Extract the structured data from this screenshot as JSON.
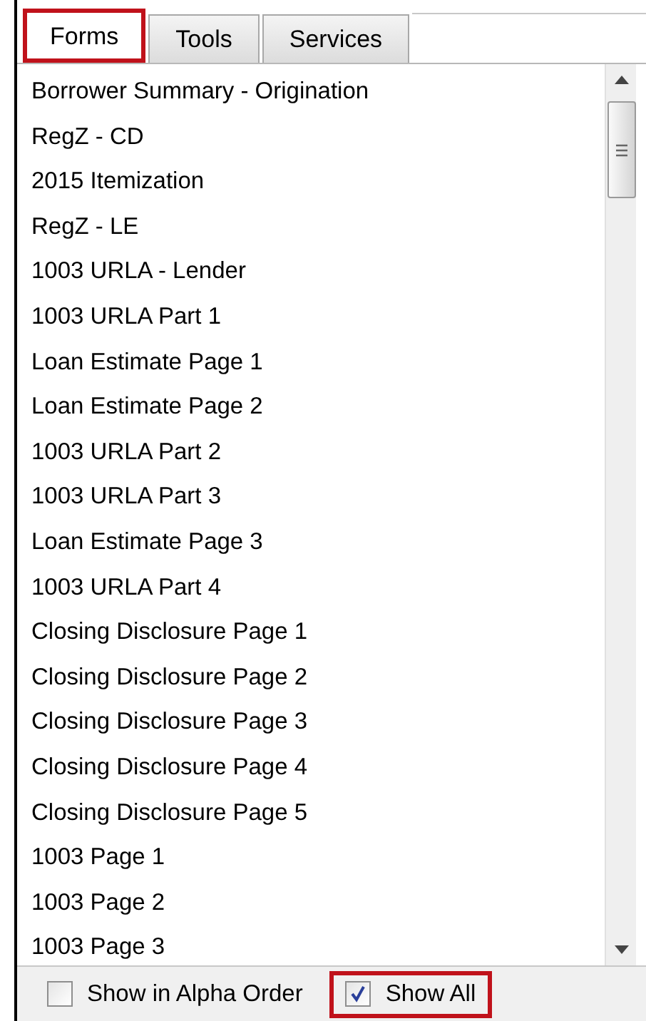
{
  "tabs": [
    {
      "label": "Forms",
      "selected": true,
      "highlighted": true
    },
    {
      "label": "Tools",
      "selected": false,
      "highlighted": false
    },
    {
      "label": "Services",
      "selected": false,
      "highlighted": false
    }
  ],
  "forms": [
    "Borrower Summary - Origination",
    "RegZ - CD",
    "2015 Itemization",
    "RegZ - LE",
    "1003 URLA - Lender",
    "1003 URLA Part 1",
    "Loan Estimate Page 1",
    "Loan Estimate Page 2",
    "1003 URLA Part 2",
    "1003 URLA Part 3",
    "Loan Estimate Page 3",
    "1003 URLA Part 4",
    "Closing Disclosure Page 1",
    "Closing Disclosure Page 2",
    "Closing Disclosure Page 3",
    "Closing Disclosure Page 4",
    "Closing Disclosure Page 5",
    "1003 Page 1",
    "1003 Page 2",
    "1003 Page 3"
  ],
  "options": [
    {
      "label": "Show in Alpha Order",
      "checked": false,
      "highlighted": false
    },
    {
      "label": "Show All",
      "checked": true,
      "highlighted": true
    }
  ]
}
